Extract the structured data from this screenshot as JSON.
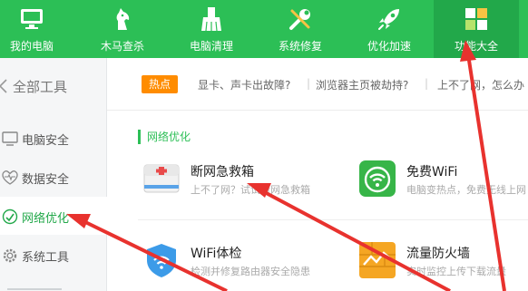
{
  "nav": {
    "items": [
      {
        "label": "我的电脑",
        "icon": "monitor-icon"
      },
      {
        "label": "木马查杀",
        "icon": "horse-icon"
      },
      {
        "label": "电脑清理",
        "icon": "broom-icon"
      },
      {
        "label": "系统修复",
        "icon": "wrench-icon"
      },
      {
        "label": "优化加速",
        "icon": "rocket-icon"
      },
      {
        "label": "功能大全",
        "icon": "grid-icon",
        "active": true
      }
    ]
  },
  "sidebar": {
    "all_label": "全部工具",
    "items": [
      {
        "label": "电脑安全",
        "icon": "monitor-icon"
      },
      {
        "label": "数据安全",
        "icon": "pulse-icon"
      },
      {
        "label": "网络优化",
        "icon": "network-icon",
        "active": true
      },
      {
        "label": "系统工具",
        "icon": "gear-icon"
      }
    ]
  },
  "hot": {
    "badge": "热点",
    "links": [
      "显卡、声卡出故障?",
      "浏览器主页被劫持?",
      "上不了网，怎么办"
    ]
  },
  "section": {
    "title": "网络优化"
  },
  "tools": [
    {
      "name": "断网急救箱",
      "desc": "上不了网？试试断网急救箱",
      "icon": "first-aid-kit-icon"
    },
    {
      "name": "免费WiFi",
      "desc": "电脑变热点，免费无线上网",
      "icon": "wifi-icon"
    },
    {
      "name": "WiFi体检",
      "desc": "检测并修复路由器安全隐患",
      "icon": "shield-wifi-icon"
    },
    {
      "name": "流量防火墙",
      "desc": "实时监控上传下载流量",
      "icon": "firewall-icon"
    }
  ],
  "colors": {
    "brand_green": "#2cbf56",
    "active_tab": "#22a84a",
    "hot_orange": "#ff8c00",
    "annotation_red": "#e8322e"
  }
}
